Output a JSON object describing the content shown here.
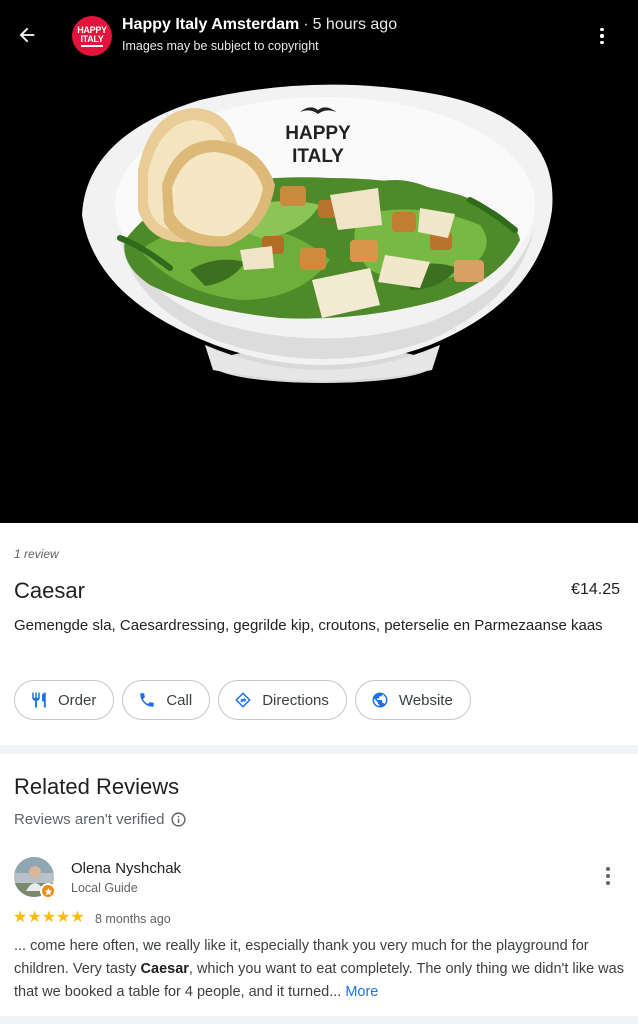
{
  "viewer": {
    "business_name": "Happy Italy Amsterdam",
    "separator": "·",
    "posted_time": "5 hours ago",
    "copyright_note": "Images may be subject to copyright",
    "logo_text_line1": "HAPPY",
    "logo_text_line2": "ITALY",
    "bowl_brand_line1": "HAPPY",
    "bowl_brand_line2": "ITALY",
    "icons": {
      "back": "arrow-left-icon",
      "menu": "more-vert-icon"
    }
  },
  "dish": {
    "review_count": "1 review",
    "name": "Caesar",
    "price": "€14.25",
    "description": "Gemengde sla, Caesardressing, gegrilde kip, croutons, peterselie en Parmezaanse kaas"
  },
  "actions": [
    {
      "label": "Order",
      "icon": "restaurant-icon"
    },
    {
      "label": "Call",
      "icon": "phone-icon"
    },
    {
      "label": "Directions",
      "icon": "directions-icon"
    },
    {
      "label": "Website",
      "icon": "globe-icon"
    }
  ],
  "related_reviews": {
    "title": "Related Reviews",
    "verification_note": "Reviews aren't verified",
    "reviews": [
      {
        "author": "Olena Nyshchak",
        "role": "Local Guide",
        "rating": 5,
        "stars": "★★★★★",
        "date": "8 months ago",
        "text_before": "... come here often, we really like it, especially thank you very much for the playground for children. Very tasty ",
        "highlight": "Caesar",
        "text_after": ", which you want to eat completely. The only thing we didn't like was that we booked a table for 4 people, and it turned... ",
        "more_label": "More"
      }
    ]
  },
  "colors": {
    "accent": "#1a73e8",
    "star": "#fbbc04",
    "logo": "#e3143c",
    "guide_badge": "#f28b18"
  }
}
